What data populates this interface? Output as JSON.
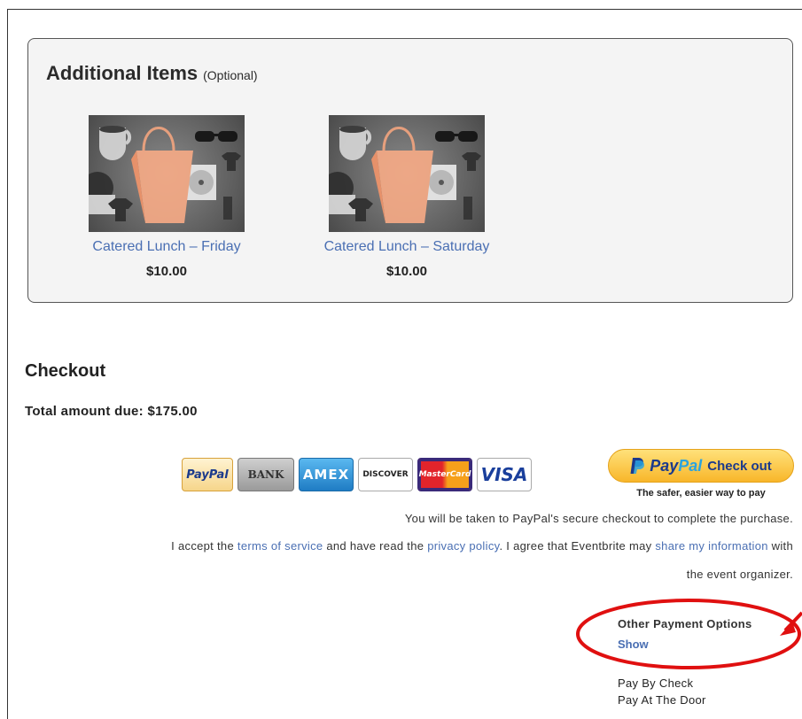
{
  "additional_items": {
    "title": "Additional Items",
    "subtitle": "(Optional)",
    "items": [
      {
        "name": "Catered Lunch – Friday",
        "price": "$10.00"
      },
      {
        "name": "Catered Lunch – Saturday",
        "price": "$10.00"
      }
    ]
  },
  "checkout": {
    "title": "Checkout",
    "total": "Total amount due: $175.00"
  },
  "payment_logos": {
    "paypal": "PayPal",
    "bank": "BANK",
    "amex": "AMEX",
    "discover": "DISCOVER",
    "mastercard": "MasterCard",
    "visa": "VISA"
  },
  "paypal_button": {
    "brand_left": "Pay",
    "brand_right": "Pal",
    "action": "Check out",
    "tagline": "The safer, easier way to pay"
  },
  "notice": "You will be taken to PayPal's secure checkout to complete the purchase.",
  "terms": {
    "t1": "I accept the ",
    "link1": "terms of service",
    "t2": " and have read the ",
    "link2": "privacy policy",
    "t3": ". I agree that Eventbrite may ",
    "link3": "share my information",
    "t4": " with",
    "t5": "the event organizer."
  },
  "other_payment": {
    "title": "Other Payment Options",
    "show": "Show",
    "options": [
      "Pay By Check",
      "Pay At The Door"
    ]
  },
  "colors": {
    "link": "#4a6fb3",
    "annotation": "#e01010",
    "paypal_gold": "#f8b62a"
  }
}
